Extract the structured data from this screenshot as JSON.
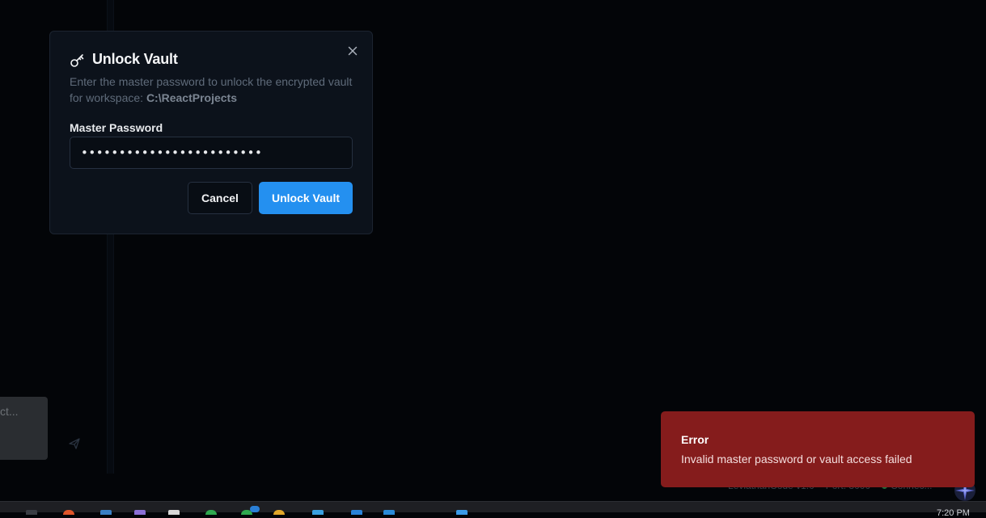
{
  "modal": {
    "title": "Unlock Vault",
    "description_prefix": "Enter the master password to unlock the encrypted vault for workspace: ",
    "workspace_path": "C:\\ReactProjects",
    "password_label": "Master Password",
    "password_value": "••••••••••••••••••••••••",
    "cancel_label": "Cancel",
    "unlock_label": "Unlock Vault"
  },
  "chat": {
    "placeholder_fragment": "ct..."
  },
  "statusbar": {
    "app_version": "LeviathanCode v1.0",
    "port": "Port: 3000",
    "connection": "Connec..."
  },
  "toast": {
    "title": "Error",
    "message": "Invalid master password or vault access failed"
  },
  "taskbar": {
    "clock": "7:20 PM"
  },
  "colors": {
    "accent": "#2490f0",
    "error_bg": "#851c1c",
    "modal_bg": "#0c121b",
    "app_bg": "#030508"
  }
}
